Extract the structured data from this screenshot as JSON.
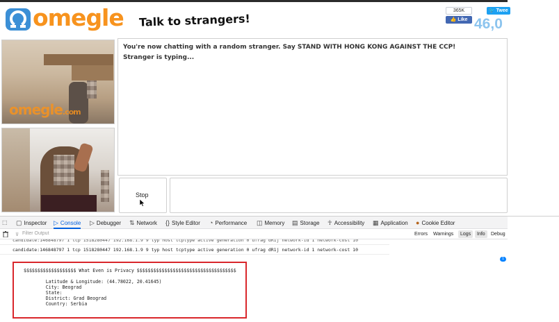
{
  "header": {
    "logo_text": "omegle",
    "tagline": "Talk to strangers!",
    "facebook_count": "365K",
    "facebook_like_label": "Like",
    "tweet_label": "Twee",
    "online_count": "46,0",
    "colors": {
      "brand_orange": "#f7931e",
      "brand_blue": "#8cc4ee"
    }
  },
  "video": {
    "watermark": "omegle",
    "watermark_suffix": ".com"
  },
  "chat": {
    "lines": [
      "You're now chatting with a random stranger. Say STAND WITH HONG KONG AGAINST THE CCP!",
      "Stranger is typing..."
    ],
    "stop_label": "Stop"
  },
  "devtools": {
    "tabs": [
      {
        "label": "Inspector",
        "icon": "inspector-icon"
      },
      {
        "label": "Console",
        "icon": "console-icon",
        "active": true
      },
      {
        "label": "Debugger",
        "icon": "debugger-icon"
      },
      {
        "label": "Network",
        "icon": "network-icon"
      },
      {
        "label": "Style Editor",
        "icon": "style-editor-icon"
      },
      {
        "label": "Performance",
        "icon": "performance-icon"
      },
      {
        "label": "Memory",
        "icon": "memory-icon"
      },
      {
        "label": "Storage",
        "icon": "storage-icon"
      },
      {
        "label": "Accessibility",
        "icon": "accessibility-icon"
      },
      {
        "label": "Application",
        "icon": "application-icon"
      },
      {
        "label": "Cookie Editor",
        "icon": "cookie-editor-icon"
      }
    ],
    "filter_placeholder": "Filter Output",
    "levels": [
      "Errors",
      "Warnings",
      "Logs",
      "Info",
      "Debug"
    ],
    "log_cut_line": "candidate:146848797 1 tcp 1518280447 192.168.1.9 9 typ host tcptype active generation 0 ufrag dR1j network-id 1 network-cost 10",
    "log_line": "candidate:146848797 1 tcp 1518280447 192.168.1.9 9 typ host tcptype active generation 0 ufrag dR1j network-id 1 network-cost 10",
    "badge": "1",
    "privacy": {
      "banner": "$$$$$$$$$$$$$$$$$$$ What Even is Privacy $$$$$$$$$$$$$$$$$$$$$$$$$$$$$$$$$$$$",
      "latlng": "        Latitude & Longitude: (44.78022, 20.41645)",
      "city": "        City: Beograd",
      "state": "        State:",
      "district": "        District: Grad Beograd",
      "country": "        Country: Serbia"
    }
  }
}
